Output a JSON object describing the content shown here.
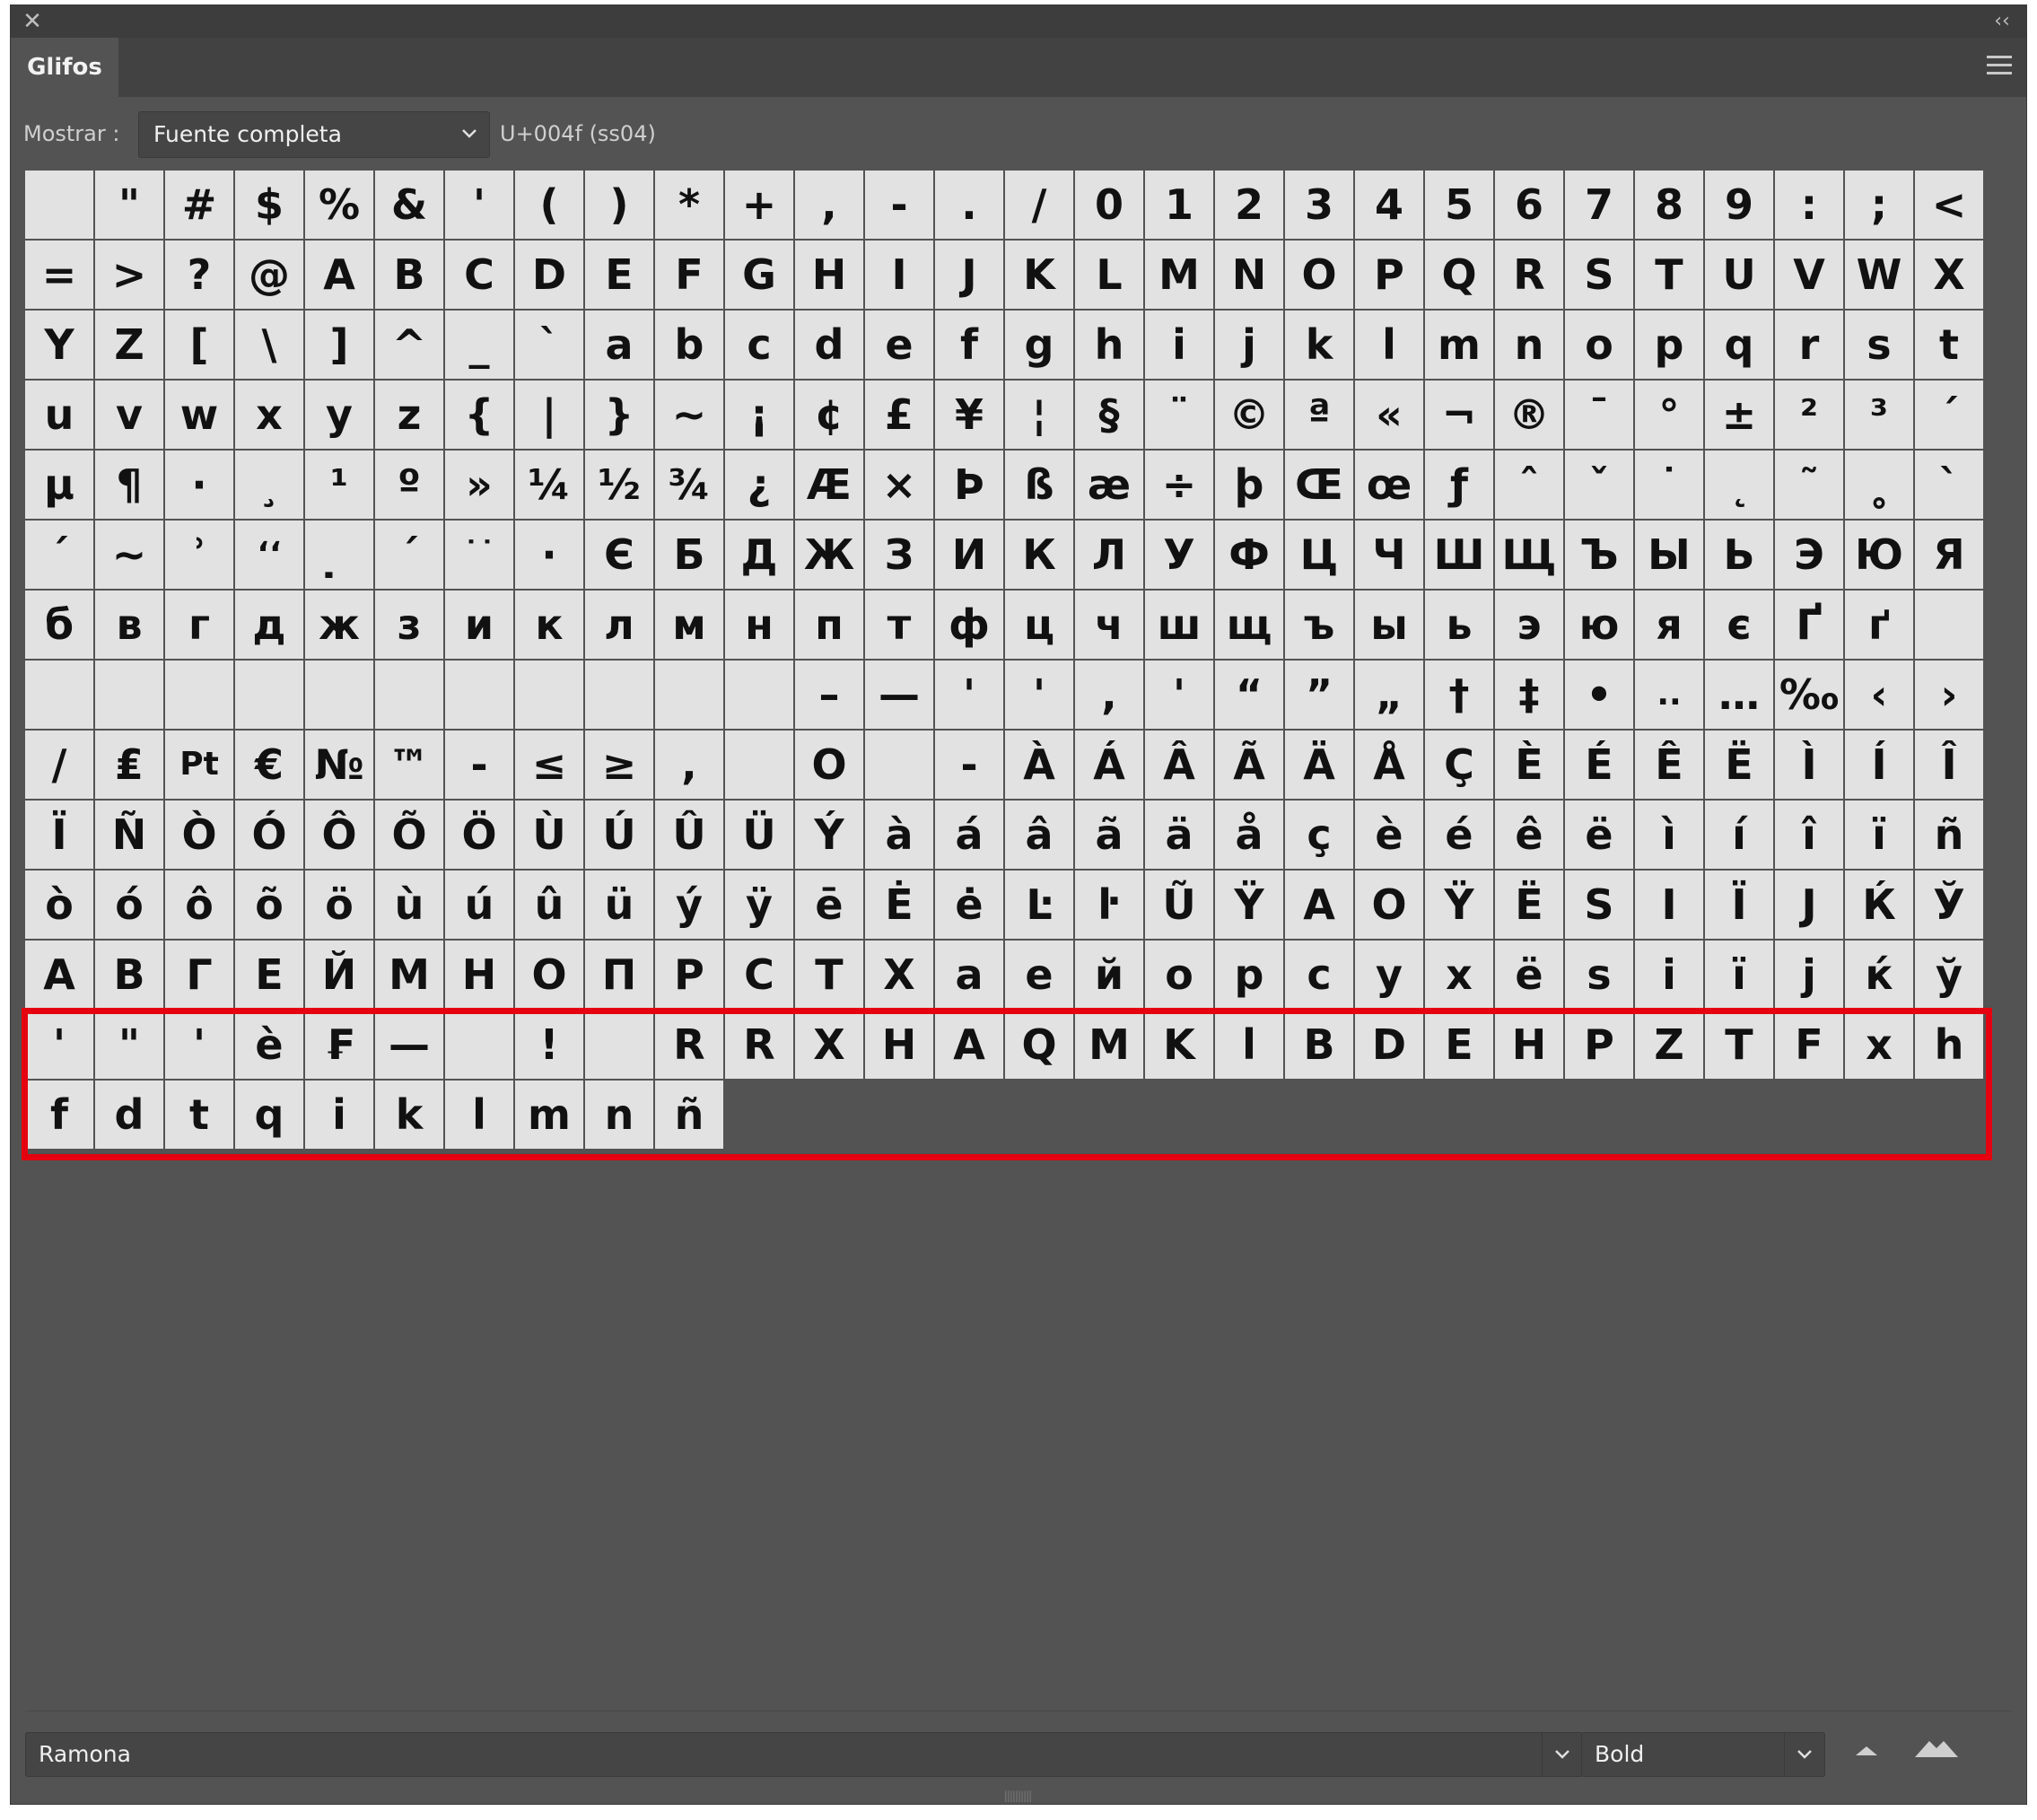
{
  "window": {
    "close_glyph": "✕",
    "collapse_glyph": "‹‹"
  },
  "tab": {
    "label": "Glifos"
  },
  "show": {
    "label": "Mostrar :",
    "value": "Fuente completa",
    "unicode_info": "U+004f (ss04)"
  },
  "grid": {
    "columns": 28,
    "rows": [
      [
        "",
        "\"",
        "#",
        "$",
        "%",
        "&",
        "'",
        "(",
        ")",
        "*",
        "+",
        ",",
        "-",
        ".",
        "/",
        "0",
        "1",
        "2",
        "3",
        "4",
        "5",
        "6",
        "7",
        "8",
        "9",
        ":",
        ";",
        "<"
      ],
      [
        "=",
        ">",
        "?",
        "@",
        "A",
        "B",
        "C",
        "D",
        "E",
        "F",
        "G",
        "H",
        "I",
        "J",
        "K",
        "L",
        "M",
        "N",
        "O",
        "P",
        "Q",
        "R",
        "S",
        "T",
        "U",
        "V",
        "W",
        "X"
      ],
      [
        "Y",
        "Z",
        "[",
        "\\",
        "]",
        "^",
        "_",
        "`",
        "a",
        "b",
        "c",
        "d",
        "e",
        "f",
        "g",
        "h",
        "i",
        "j",
        "k",
        "l",
        "m",
        "n",
        "o",
        "p",
        "q",
        "r",
        "s",
        "t"
      ],
      [
        "u",
        "v",
        "w",
        "x",
        "y",
        "z",
        "{",
        "|",
        "}",
        "~",
        "¡",
        "¢",
        "£",
        "¥",
        "¦",
        "§",
        "¨",
        "©",
        "ª",
        "«",
        "¬",
        "®",
        "¯",
        "°",
        "±",
        "²",
        "³",
        "´"
      ],
      [
        "µ",
        "¶",
        "·",
        "¸",
        "¹",
        "º",
        "»",
        "¼",
        "½",
        "¾",
        "¿",
        "Æ",
        "×",
        "Þ",
        "ß",
        "æ",
        "÷",
        "þ",
        "Œ",
        "œ",
        "ƒ",
        "ˆ",
        "ˇ",
        "˙",
        "˛",
        "˜",
        "˳",
        "`"
      ],
      [
        "´",
        "~",
        "ʾ",
        "ʻʻ",
        "̣",
        "ˊ",
        "˙˙",
        "·",
        "Є",
        "Б",
        "Д",
        "Ж",
        "З",
        "И",
        "К",
        "Л",
        "У",
        "Ф",
        "Ц",
        "Ч",
        "Ш",
        "Щ",
        "Ъ",
        "Ы",
        "Ь",
        "Э",
        "Ю",
        "Я"
      ],
      [
        "б",
        "в",
        "г",
        "д",
        "ж",
        "з",
        "и",
        "к",
        "л",
        "м",
        "н",
        "п",
        "т",
        "ф",
        "ц",
        "ч",
        "ш",
        "щ",
        "ъ",
        "ы",
        "ь",
        "э",
        "ю",
        "я",
        "є",
        "Ґ",
        "ґ",
        ""
      ],
      [
        "",
        "",
        "",
        "",
        "",
        "",
        "",
        "",
        "",
        "",
        "",
        "–",
        "—",
        "'",
        "'",
        ",",
        "'",
        "“",
        "”",
        "„",
        "†",
        "‡",
        "•",
        "..",
        "…",
        "‰",
        "‹",
        "›"
      ],
      [
        "/",
        "₤",
        "Pt",
        "€",
        "№",
        "™",
        "-",
        "≤",
        "≥",
        ",",
        "",
        "O",
        "",
        "-",
        "À",
        "Á",
        "Â",
        "Ã",
        "Ä",
        "Å",
        "Ç",
        "È",
        "É",
        "Ê",
        "Ë",
        "Ì",
        "Í",
        "Î"
      ],
      [
        "Ï",
        "Ñ",
        "Ò",
        "Ó",
        "Ô",
        "Õ",
        "Ö",
        "Ù",
        "Ú",
        "Û",
        "Ü",
        "Ý",
        "à",
        "á",
        "â",
        "ã",
        "ä",
        "å",
        "ç",
        "è",
        "é",
        "ê",
        "ë",
        "ì",
        "í",
        "î",
        "ï",
        "ñ"
      ],
      [
        "ò",
        "ó",
        "ô",
        "õ",
        "ö",
        "ù",
        "ú",
        "û",
        "ü",
        "ý",
        "ÿ",
        "ē",
        "Ė",
        "ė",
        "Ŀ",
        "ŀ",
        "Ũ",
        "Ÿ",
        "A",
        "O",
        "Ÿ",
        "Ë",
        "S",
        "I",
        "Ï",
        "J",
        "Ќ",
        "Ў"
      ],
      [
        "А",
        "В",
        "Г",
        "Е",
        "Й",
        "М",
        "Н",
        "О",
        "П",
        "Р",
        "С",
        "Т",
        "Х",
        "а",
        "е",
        "й",
        "о",
        "р",
        "с",
        "у",
        "х",
        "ё",
        "ѕ",
        "і",
        "ї",
        "ј",
        "ќ",
        "ў"
      ],
      [
        "'",
        "\"",
        "'",
        "è",
        "₣",
        "—",
        "",
        "!",
        "",
        "R",
        "R",
        "X",
        "H",
        "A",
        "Q",
        "M",
        "K",
        "l",
        "B",
        "D",
        "E",
        "H",
        "P",
        "Z",
        "T",
        "F",
        "x",
        "h"
      ],
      [
        "f",
        "d",
        "t",
        "q",
        "i",
        "k",
        "l",
        "m",
        "n",
        "ñ"
      ]
    ]
  },
  "footer": {
    "font_family": "Ramona",
    "font_style": "Bold",
    "chevron": "⌄"
  },
  "colors": {
    "panel_bg": "#535353",
    "cell_bg": "#e2e2e2",
    "highlight": "#e4000f"
  },
  "icons": [
    "close-icon",
    "collapse-icon",
    "panel-menu-icon",
    "chevron-down-icon",
    "zoom-out-icon",
    "zoom-in-icon"
  ]
}
